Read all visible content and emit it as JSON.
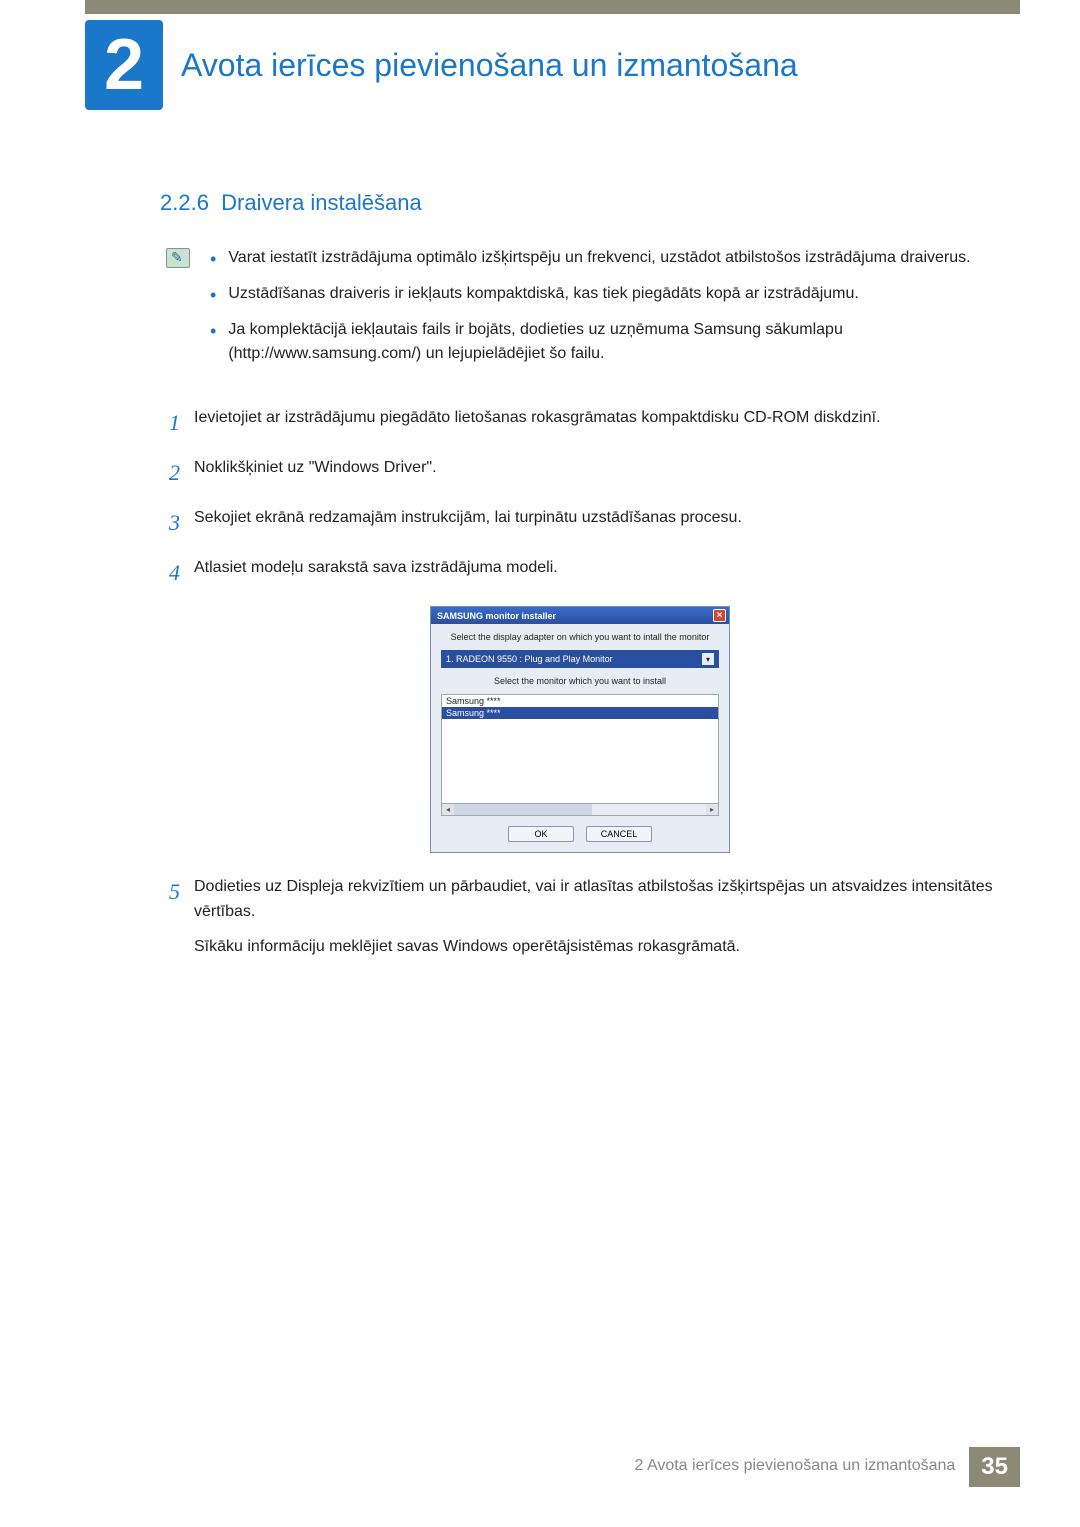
{
  "chapter": {
    "number": "2",
    "title": "Avota ierīces pievienošana un izmantošana"
  },
  "section": {
    "number": "2.2.6",
    "title": "Draivera instalēšana"
  },
  "notes": [
    "Varat iestatīt izstrādājuma optimālo izšķirtspēju un frekvenci, uzstādot atbilstošos izstrādājuma draiverus.",
    "Uzstādīšanas draiveris ir iekļauts kompaktdiskā, kas tiek piegādāts kopā ar izstrādājumu.",
    "Ja komplektācijā iekļautais fails ir bojāts, dodieties uz uzņēmuma Samsung sākumlapu (http://www.samsung.com/) un lejupielādējiet šo failu."
  ],
  "steps": [
    {
      "n": "1",
      "text": "Ievietojiet ar izstrādājumu piegādāto lietošanas rokasgrāmatas kompaktdisku CD-ROM diskdzinī."
    },
    {
      "n": "2",
      "text": "Noklikšķiniet uz \"Windows Driver\"."
    },
    {
      "n": "3",
      "text": "Sekojiet ekrānā redzamajām instrukcijām, lai turpinātu uzstādīšanas procesu."
    },
    {
      "n": "4",
      "text": "Atlasiet modeļu sarakstā sava izstrādājuma modeli."
    },
    {
      "n": "5",
      "text": "Dodieties uz Displeja rekvizītiem un pārbaudiet, vai ir atlasītas atbilstošas izšķirtspējas un atsvaidzes intensitātes vērtības.",
      "extra": "Sīkāku informāciju meklējiet savas Windows operētājsistēmas rokasgrāmatā."
    }
  ],
  "dialog": {
    "title": "SAMSUNG monitor installer",
    "label1": "Select the display adapter on which you want to intall the monitor",
    "adapter": "1. RADEON 9550 : Plug and Play Monitor",
    "label2": "Select the monitor which you want to install",
    "list": [
      "Samsung ****",
      "Samsung ****"
    ],
    "ok": "OK",
    "cancel": "CANCEL"
  },
  "footer": {
    "text": "2 Avota ierīces pievienošana un izmantošana",
    "page": "35"
  }
}
